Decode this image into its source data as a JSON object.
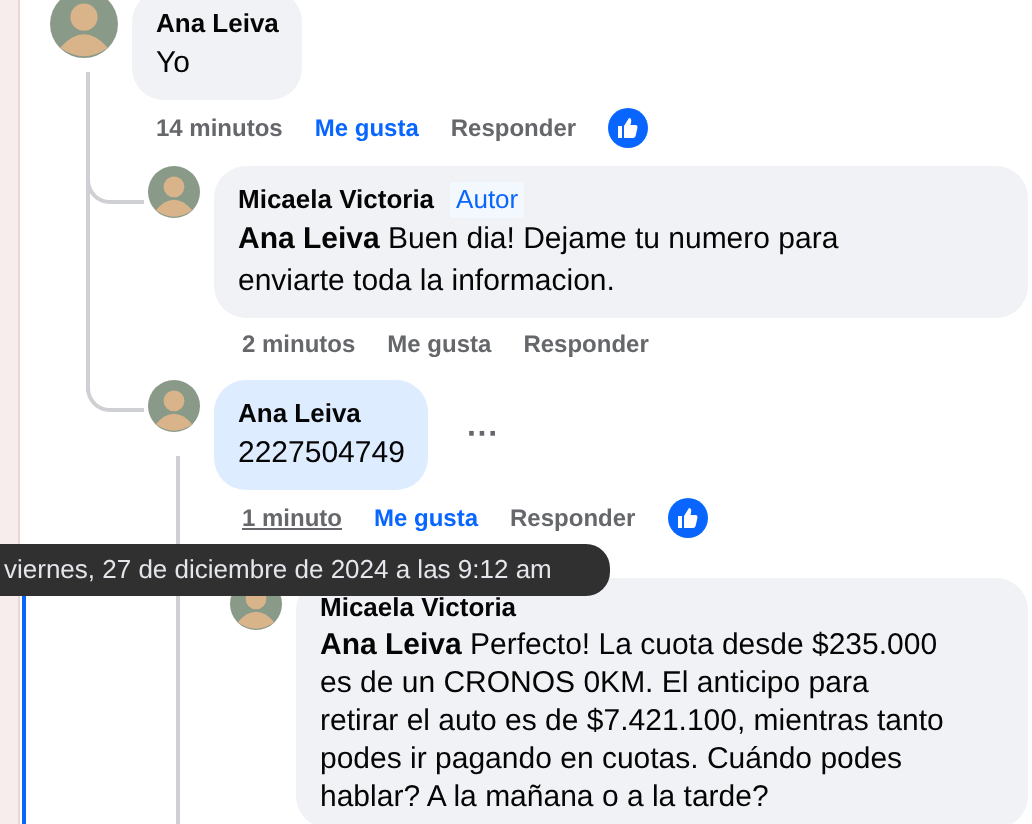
{
  "comments": [
    {
      "author": "Ana Leiva",
      "text": "Yo",
      "highlighted": false,
      "time": "14 minutos",
      "time_hovered": false,
      "like_label": "Me gusta",
      "liked": true,
      "reply_label": "Responder",
      "children": [
        {
          "author": "Micaela Victoria",
          "badge": "Autor",
          "mention": "Ana Leiva",
          "text": "Buen dia! Dejame tu numero para enviarte toda la informacion.",
          "highlighted": false,
          "time": "2 minutos",
          "time_hovered": false,
          "like_label": "Me gusta",
          "liked": false,
          "reply_label": "Responder"
        },
        {
          "author": "Ana Leiva",
          "text": "2227504749",
          "highlighted": true,
          "more": "···",
          "time": "1 minuto",
          "time_hovered": true,
          "like_label": "Me gusta",
          "liked": true,
          "reply_label": "Responder",
          "children": [
            {
              "author": "Micaela Victoria",
              "mention": "Ana Leiva",
              "text": "Perfecto! La cuota desde $235.000 es de un CRONOS 0KM. El anticipo para retirar el auto es de $7.421.100, mientras tanto podes ir pagando en cuotas. Cuándo podes hablar? A la mañana o a la tarde?",
              "highlighted": false
            }
          ]
        }
      ]
    }
  ],
  "tooltip": {
    "text": "viernes, 27 de diciembre de 2024 a las 9:12 am"
  }
}
